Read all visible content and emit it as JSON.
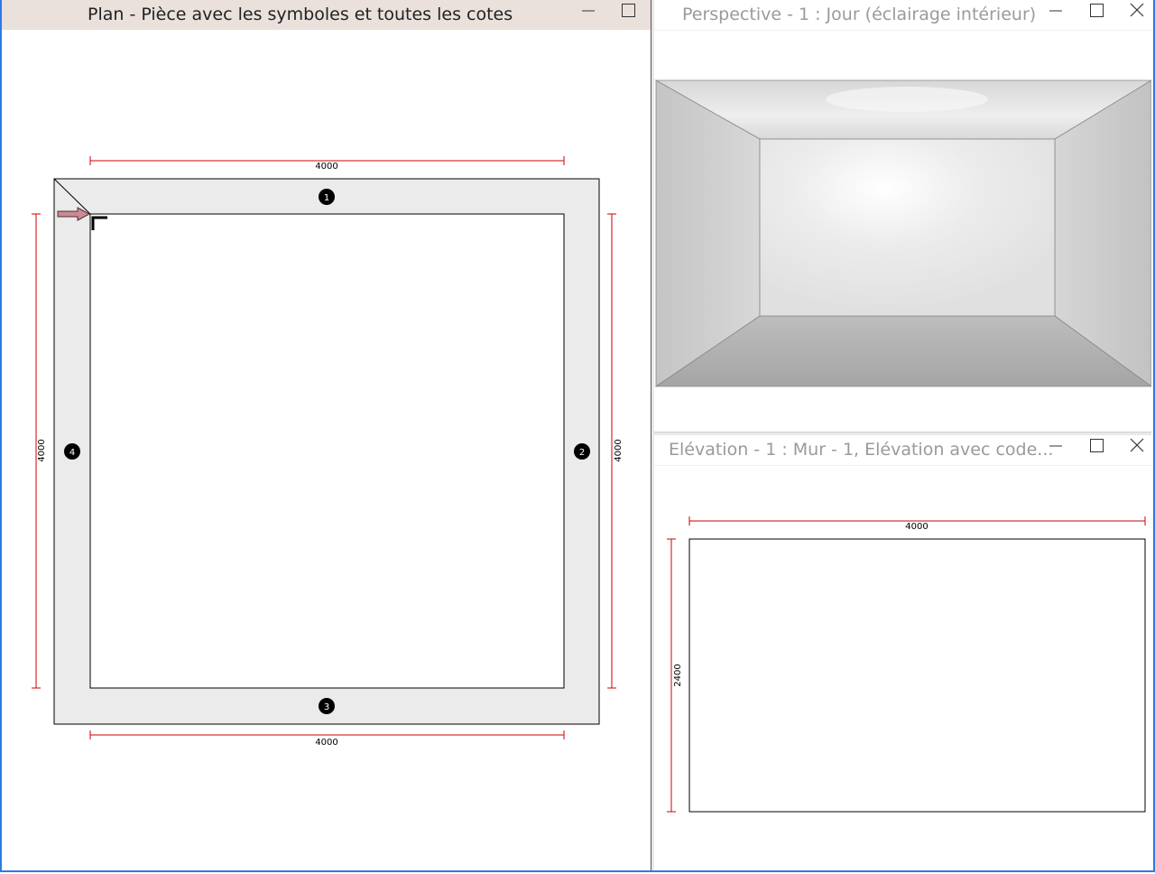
{
  "plan": {
    "title": "Plan - Pièce avec les symboles et toutes les cotes",
    "dims": {
      "top": "4000",
      "bottom": "4000",
      "left": "4000",
      "right": "4000"
    },
    "wall_markers": [
      "1",
      "2",
      "3",
      "4"
    ]
  },
  "perspective": {
    "title": "Perspective - 1 : Jour (éclairage intérieur)"
  },
  "elevation": {
    "title": "Elévation - 1 : Mur - 1, Elévation avec code...",
    "dims": {
      "width": "4000",
      "height": "2400"
    }
  },
  "colors": {
    "accent": "#2c7be5",
    "active_title": "#eae0dc",
    "dimension_line": "#cc0000",
    "wall_fill": "#ebebeb"
  },
  "icons": {
    "minimize": "minimize-icon",
    "maximize": "maximize-icon",
    "close": "close-icon",
    "north_arrow": "arrow-right-icon"
  }
}
